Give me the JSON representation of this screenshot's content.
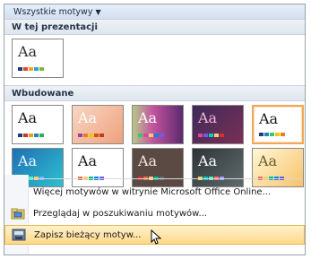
{
  "header": {
    "title": "Wszystkie motywy",
    "dropdown_icon": "caret-down-icon"
  },
  "sections": {
    "in_presentation": "W tej prezentacji",
    "builtin": "Wbudowane"
  },
  "thumbnails": {
    "presentation": [
      {
        "text": "Aa"
      }
    ],
    "builtin_row1": [
      {
        "text": "Aa"
      },
      {
        "text": "Aa"
      },
      {
        "text": "Aa"
      },
      {
        "text": "Aa"
      },
      {
        "text": "Aa"
      }
    ],
    "builtin_row2": [
      {
        "text": "Aa"
      },
      {
        "text": "Aa"
      },
      {
        "text": "Aa"
      },
      {
        "text": "Aa"
      },
      {
        "text": "Aa"
      }
    ]
  },
  "menu": [
    {
      "label": "Więcej motywów w witrynie Microsoft Office Online...",
      "icon": ""
    },
    {
      "label": "Przeglądaj w poszukiwaniu motywów...",
      "icon": "open-folder-icon"
    },
    {
      "label": "Zapisz bieżący motyw...",
      "icon": "save-theme-icon"
    }
  ]
}
